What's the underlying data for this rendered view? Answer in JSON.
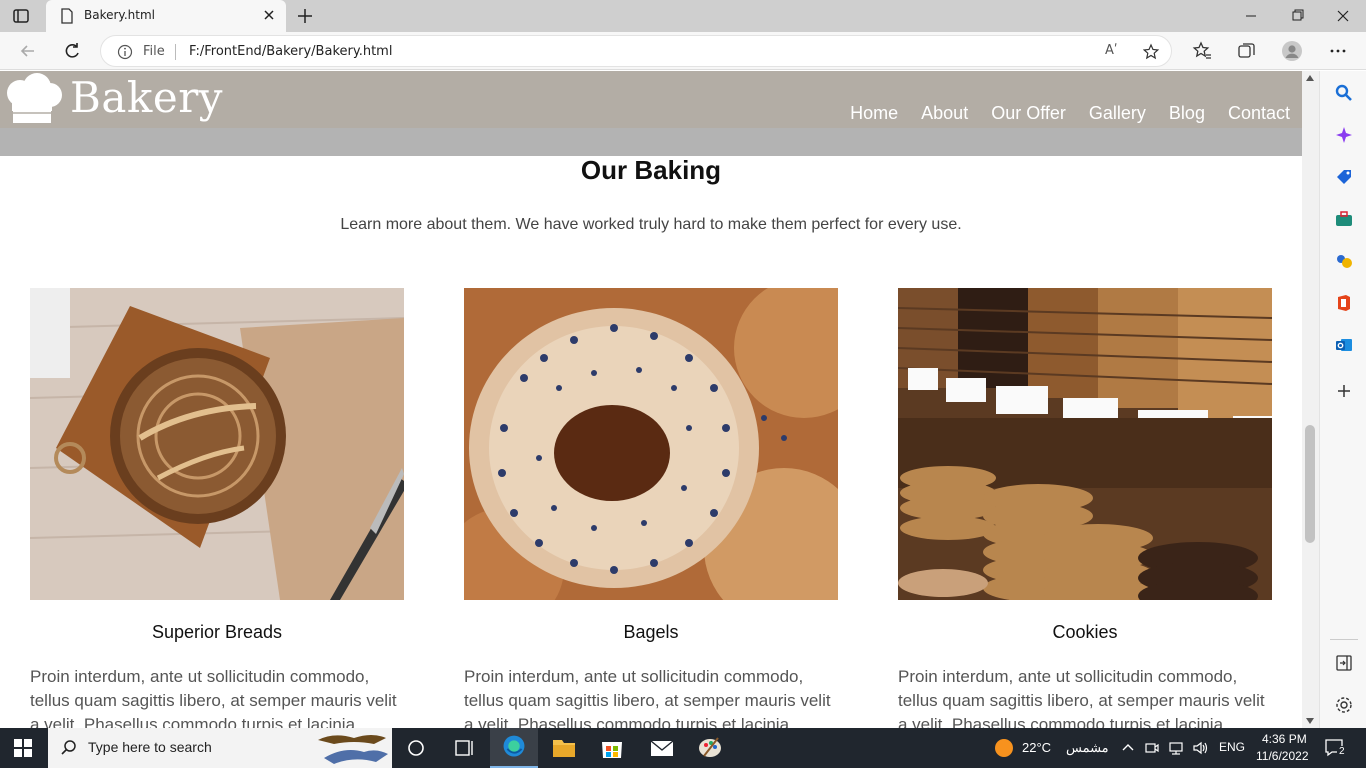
{
  "browser": {
    "tab_title": "Bakery.html",
    "address_prefix": "File",
    "url": "F:/FrontEnd/Bakery/Bakery.html",
    "read_aloud": "Aʹ"
  },
  "site": {
    "brand": "Bakery",
    "nav": [
      "Home",
      "About",
      "Our Offer",
      "Gallery",
      "Blog",
      "Contact"
    ]
  },
  "section": {
    "title": "Our Baking",
    "subtitle": "Learn more about them. We have worked truly hard to make them perfect for every use."
  },
  "cards": [
    {
      "title": "Superior Breads",
      "text": "Proin interdum, ante ut sollicitudin commodo, tellus quam sagittis libero, at semper mauris velit a velit. Phasellus commodo turpis et lacinia"
    },
    {
      "title": "Bagels",
      "text": "Proin interdum, ante ut sollicitudin commodo, tellus quam sagittis libero, at semper mauris velit a velit. Phasellus commodo turpis et lacinia"
    },
    {
      "title": "Cookies",
      "text": "Proin interdum, ante ut sollicitudin commodo, tellus quam sagittis libero, at semper mauris velit a velit. Phasellus commodo turpis et lacinia"
    }
  ],
  "taskbar": {
    "search_placeholder": "Type here to search",
    "weather": "22°C",
    "weather_text": "مشمس",
    "lang": "ENG",
    "time": "4:36 PM",
    "date": "11/6/2022",
    "notifications": "2"
  },
  "colors": {
    "header_bg": "#b3ada5",
    "header_band": "#b3b3b3",
    "taskbar_bg": "#20262e"
  }
}
